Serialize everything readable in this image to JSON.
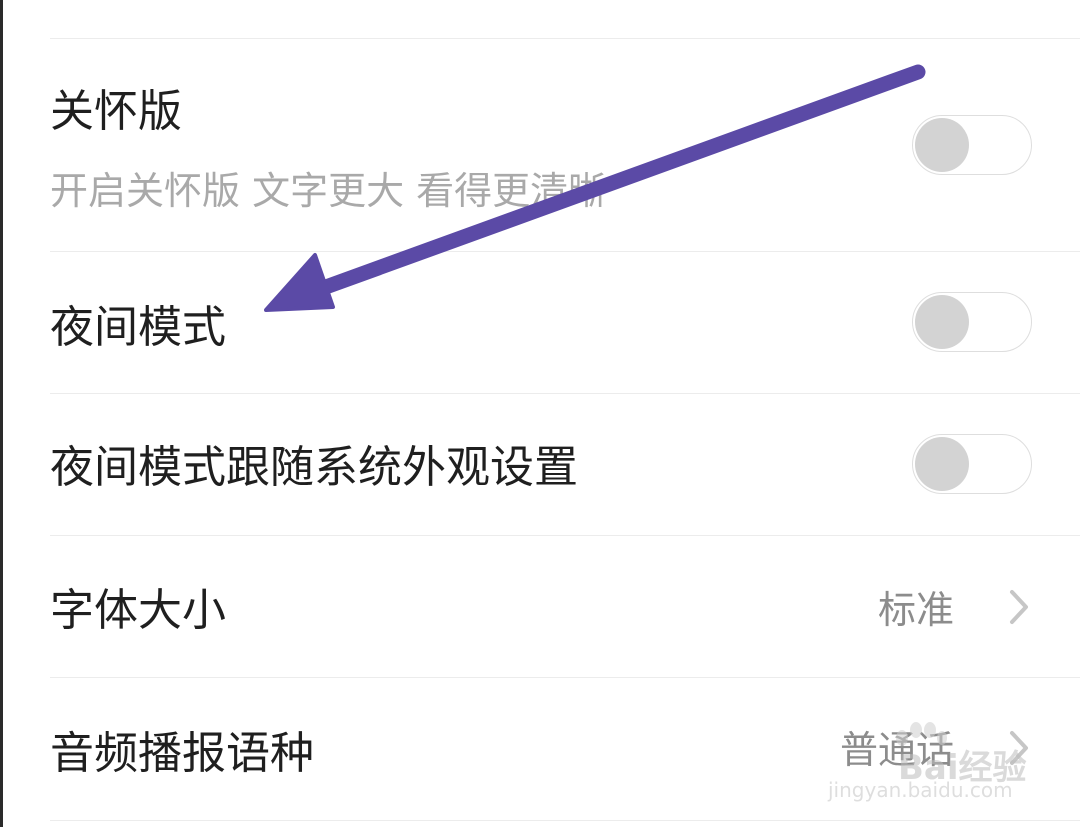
{
  "settings": {
    "care_mode": {
      "title": "关怀版",
      "subtitle": "开启关怀版 文字更大 看得更清晰",
      "enabled": false
    },
    "night_mode": {
      "title": "夜间模式",
      "enabled": false
    },
    "night_follow_system": {
      "title": "夜间模式跟随系统外观设置",
      "enabled": false
    },
    "font_size": {
      "title": "字体大小",
      "value": "标准"
    },
    "audio_language": {
      "title": "音频播报语种",
      "value": "普通话"
    }
  },
  "watermark": {
    "brand": "Bai经验",
    "url": "jingyan.baidu.com"
  },
  "colors": {
    "arrow": "#5b4aa6",
    "toggle_off_knob": "#d3d3d3",
    "divider": "#ececec",
    "title_text": "#1f1f1f",
    "subtitle_text": "#a9a9a9"
  },
  "icons": {
    "toggle": "toggle-switch-off",
    "chevron": "chevron-right-icon",
    "annotation": "arrow-annotation"
  }
}
